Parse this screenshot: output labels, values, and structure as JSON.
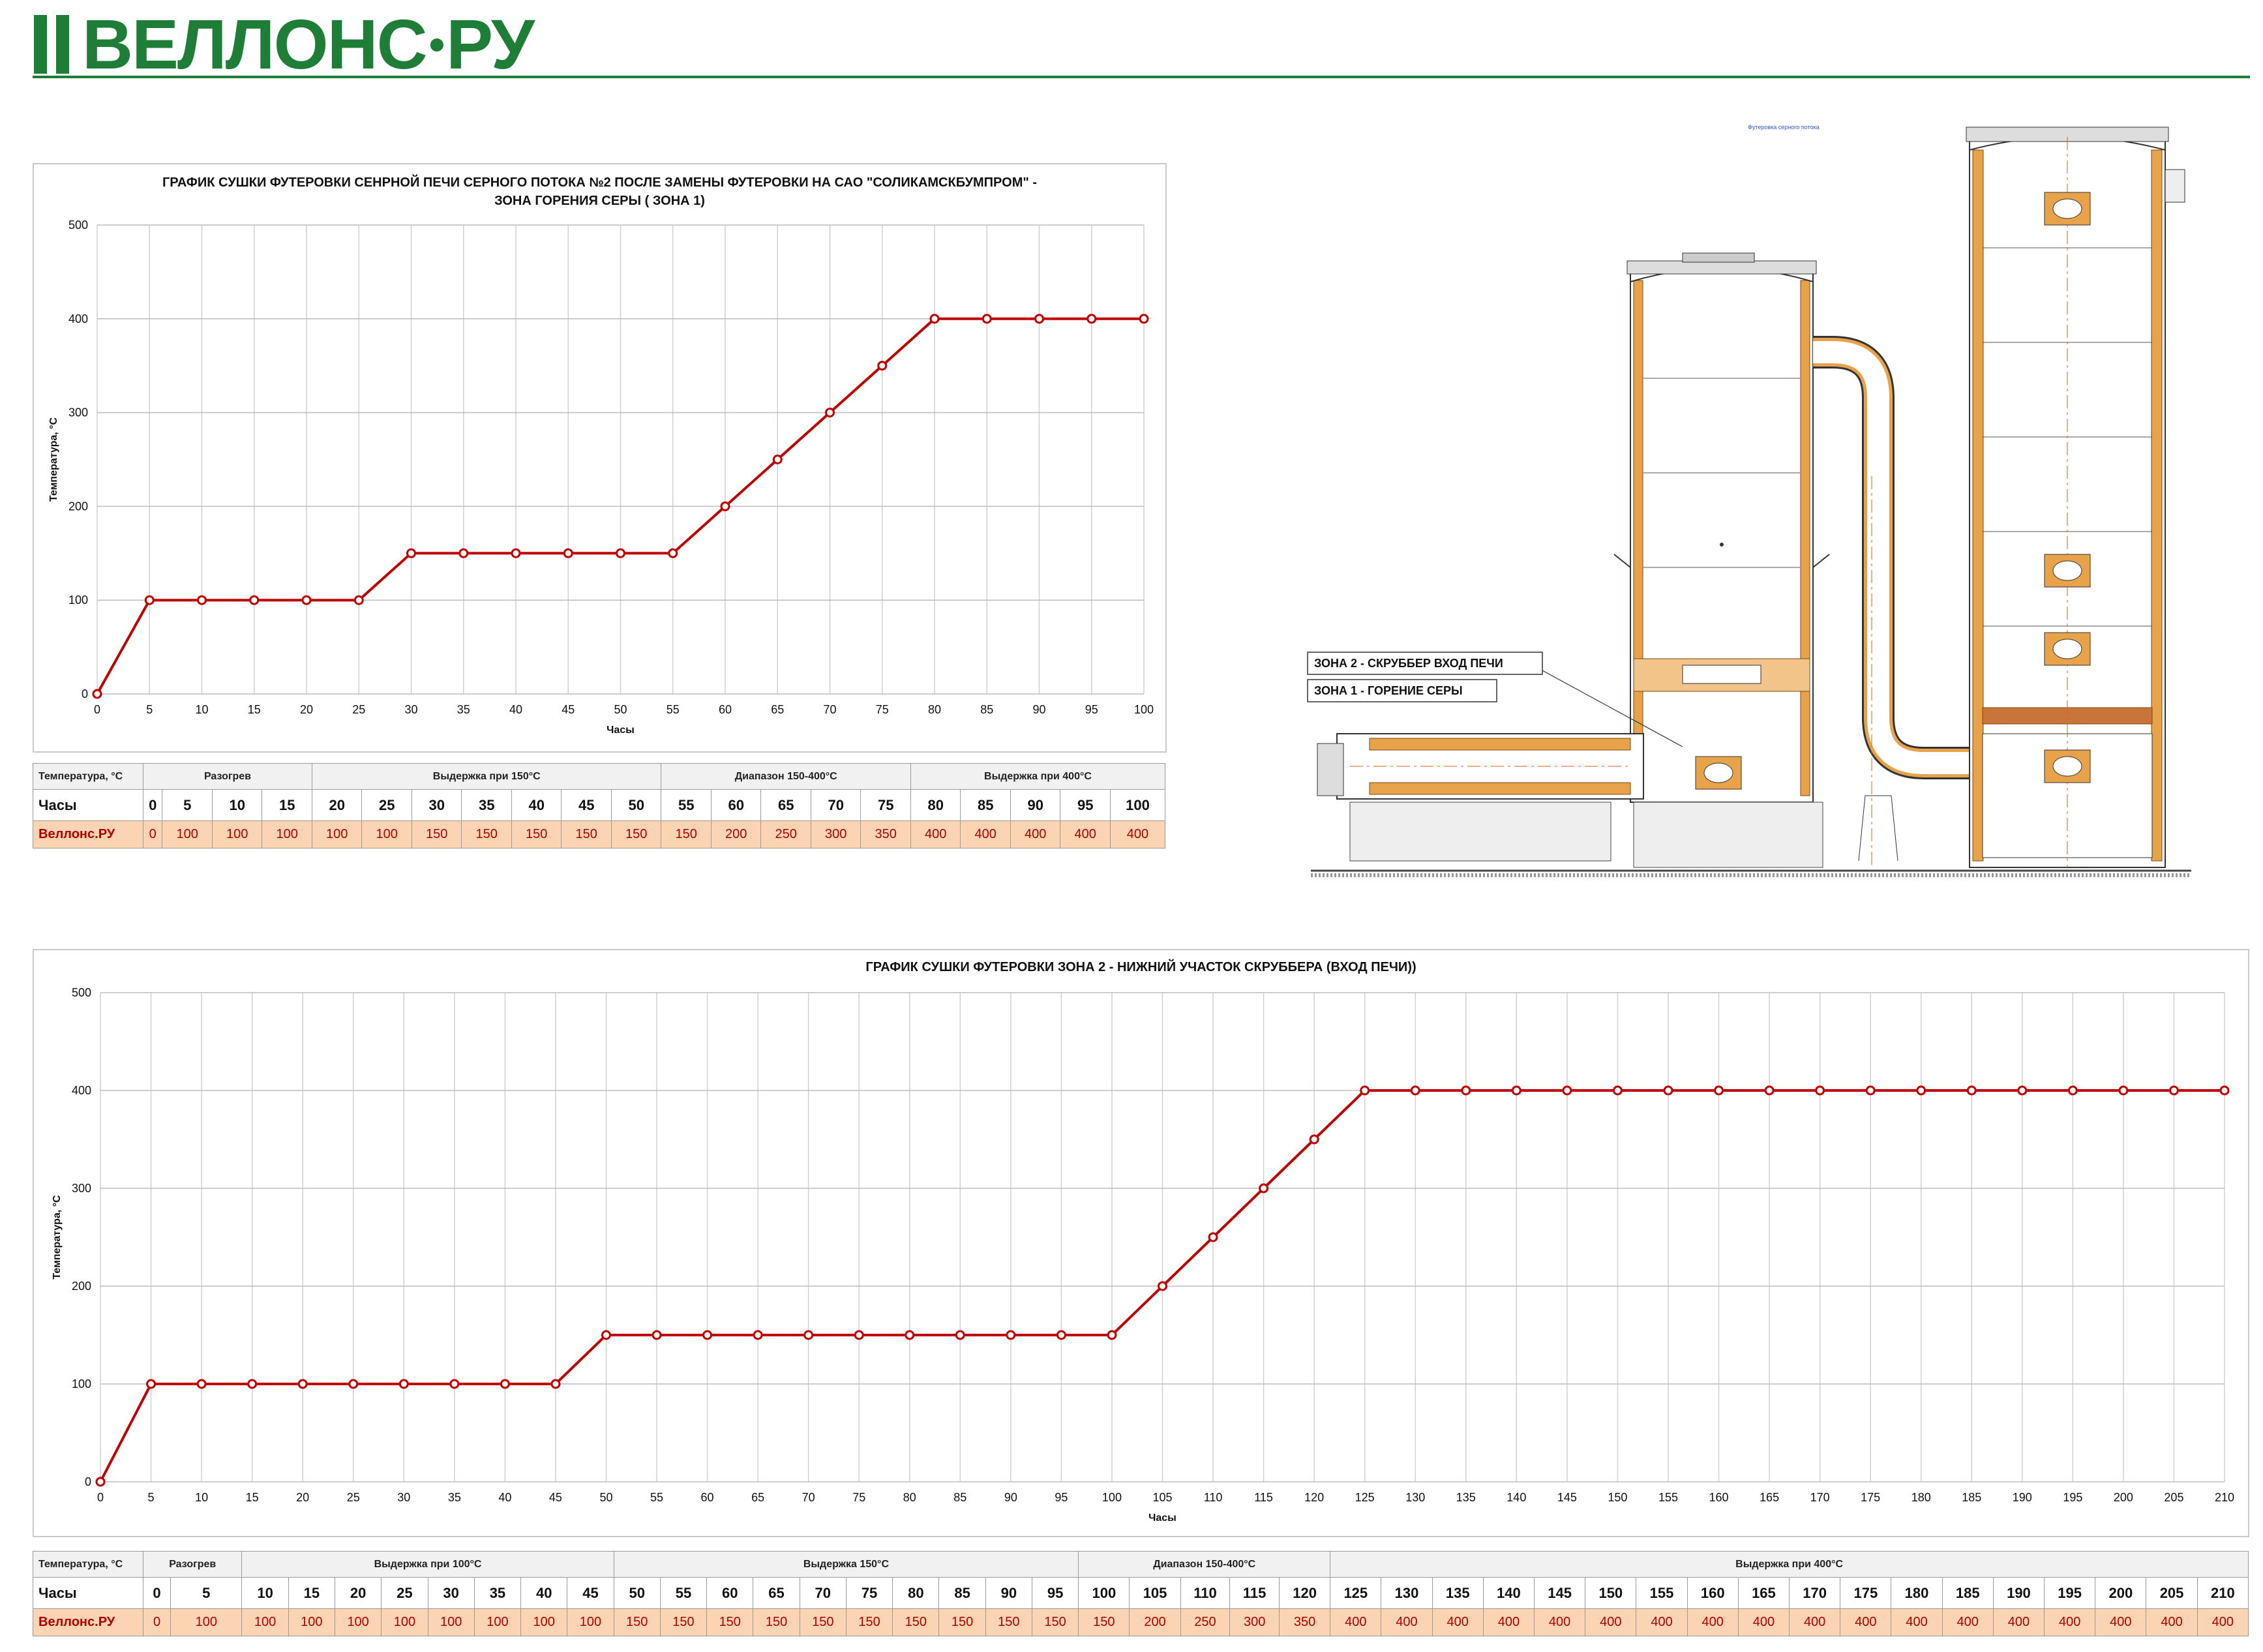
{
  "brand": {
    "name": "ВЕЛЛОНС",
    "dot": "•",
    "suffix": "РУ",
    "color": "#1e7d36"
  },
  "accent": "#c00000",
  "chart_data": [
    {
      "type": "line",
      "title": "ГРАФИК СУШКИ ФУТЕРОВКИ СЕНРНОЙ ПЕЧИ  СЕРНОГО ПОТОКА №2 ПОСЛЕ ЗАМЕНЫ ФУТЕРОВКИ  НА САО \"СОЛИКАМСКБУМПРОМ\" -",
      "subtitle": "ЗОНА ГОРЕНИЯ СЕРЫ  ( ЗОНА 1)",
      "xlabel": "Часы",
      "ylabel": "Температура, °С",
      "xlim": [
        0,
        100
      ],
      "ylim": [
        0,
        500
      ],
      "yticks": [
        0,
        100,
        200,
        300,
        400,
        500
      ],
      "x": [
        0,
        5,
        10,
        15,
        20,
        25,
        30,
        35,
        40,
        45,
        50,
        55,
        60,
        65,
        70,
        75,
        80,
        85,
        90,
        95,
        100
      ],
      "series": [
        {
          "values": [
            0,
            100,
            100,
            100,
            100,
            100,
            150,
            150,
            150,
            150,
            150,
            150,
            200,
            250,
            300,
            350,
            400,
            400,
            400,
            400,
            400
          ],
          "color": "#c00000"
        }
      ],
      "grid": true
    },
    {
      "type": "line",
      "title": "ГРАФИК СУШКИ ФУТЕРОВКИ   ЗОНА 2 - НИЖНИЙ УЧАСТОК СКРУББЕРА (ВХОД ПЕЧИ))",
      "xlabel": "Часы",
      "ylabel": "Температура, °С",
      "xlim": [
        0,
        210
      ],
      "ylim": [
        0,
        500
      ],
      "yticks": [
        0,
        100,
        200,
        300,
        400,
        500
      ],
      "x": [
        0,
        5,
        10,
        15,
        20,
        25,
        30,
        35,
        40,
        45,
        50,
        55,
        60,
        65,
        70,
        75,
        80,
        85,
        90,
        95,
        100,
        105,
        110,
        115,
        120,
        125,
        130,
        135,
        140,
        145,
        150,
        155,
        160,
        165,
        170,
        175,
        180,
        185,
        190,
        195,
        200,
        205,
        210
      ],
      "series": [
        {
          "values": [
            0,
            100,
            100,
            100,
            100,
            100,
            100,
            100,
            100,
            100,
            150,
            150,
            150,
            150,
            150,
            150,
            150,
            150,
            150,
            150,
            150,
            200,
            250,
            300,
            350,
            400,
            400,
            400,
            400,
            400,
            400,
            400,
            400,
            400,
            400,
            400,
            400,
            400,
            400,
            400,
            400,
            400,
            400
          ],
          "color": "#c00000"
        }
      ],
      "grid": true
    }
  ],
  "table1": {
    "header_label": "Температура, °С",
    "groups": [
      {
        "label": "Разогрев",
        "span": 4
      },
      {
        "label": "Выдержка при 150°С",
        "span": 7
      },
      {
        "label": "Диапазон 150-400°С",
        "span": 5
      },
      {
        "label": "Выдержка при 400°С",
        "span": 5
      }
    ],
    "hours_label": "Часы",
    "hours": [
      "0",
      "5",
      "10",
      "15",
      "20",
      "25",
      "30",
      "35",
      "40",
      "45",
      "50",
      "55",
      "60",
      "65",
      "70",
      "75",
      "80",
      "85",
      "90",
      "95",
      "100"
    ],
    "series_label": "Веллонс.РУ",
    "values": [
      "0",
      "100",
      "100",
      "100",
      "100",
      "100",
      "150",
      "150",
      "150",
      "150",
      "150",
      "150",
      "200",
      "250",
      "300",
      "350",
      "400",
      "400",
      "400",
      "400",
      "400"
    ]
  },
  "table2": {
    "header_label": "Температура, °С",
    "groups": [
      {
        "label": "Разогрев",
        "span": 2
      },
      {
        "label": "Выдержка при 100°С",
        "span": 8
      },
      {
        "label": "Выдержка 150°С",
        "span": 10
      },
      {
        "label": "Диапазон 150-400°С",
        "span": 5
      },
      {
        "label": "Выдержка при 400°С",
        "span": 18
      }
    ],
    "hours_label": "Часы",
    "hours": [
      "0",
      "5",
      "10",
      "15",
      "20",
      "25",
      "30",
      "35",
      "40",
      "45",
      "50",
      "55",
      "60",
      "65",
      "70",
      "75",
      "80",
      "85",
      "90",
      "95",
      "100",
      "105",
      "110",
      "115",
      "120",
      "125",
      "130",
      "135",
      "140",
      "145",
      "150",
      "155",
      "160",
      "165",
      "170",
      "175",
      "180",
      "185",
      "190",
      "195",
      "200",
      "205",
      "210"
    ],
    "series_label": "Веллонс.РУ",
    "values": [
      "0",
      "100",
      "100",
      "100",
      "100",
      "100",
      "100",
      "100",
      "100",
      "100",
      "150",
      "150",
      "150",
      "150",
      "150",
      "150",
      "150",
      "150",
      "150",
      "150",
      "150",
      "200",
      "250",
      "300",
      "350",
      "400",
      "400",
      "400",
      "400",
      "400",
      "400",
      "400",
      "400",
      "400",
      "400",
      "400",
      "400",
      "400",
      "400",
      "400",
      "400",
      "400",
      "400"
    ]
  },
  "drawing": {
    "zone2_label": "ЗОНА 2 - СКРУББЕР  ВХОД ПЕЧИ",
    "zone1_label": "ЗОНА 1 - ГОРЕНИЕ СЕРЫ",
    "caption": "Футеровка серного потока"
  }
}
